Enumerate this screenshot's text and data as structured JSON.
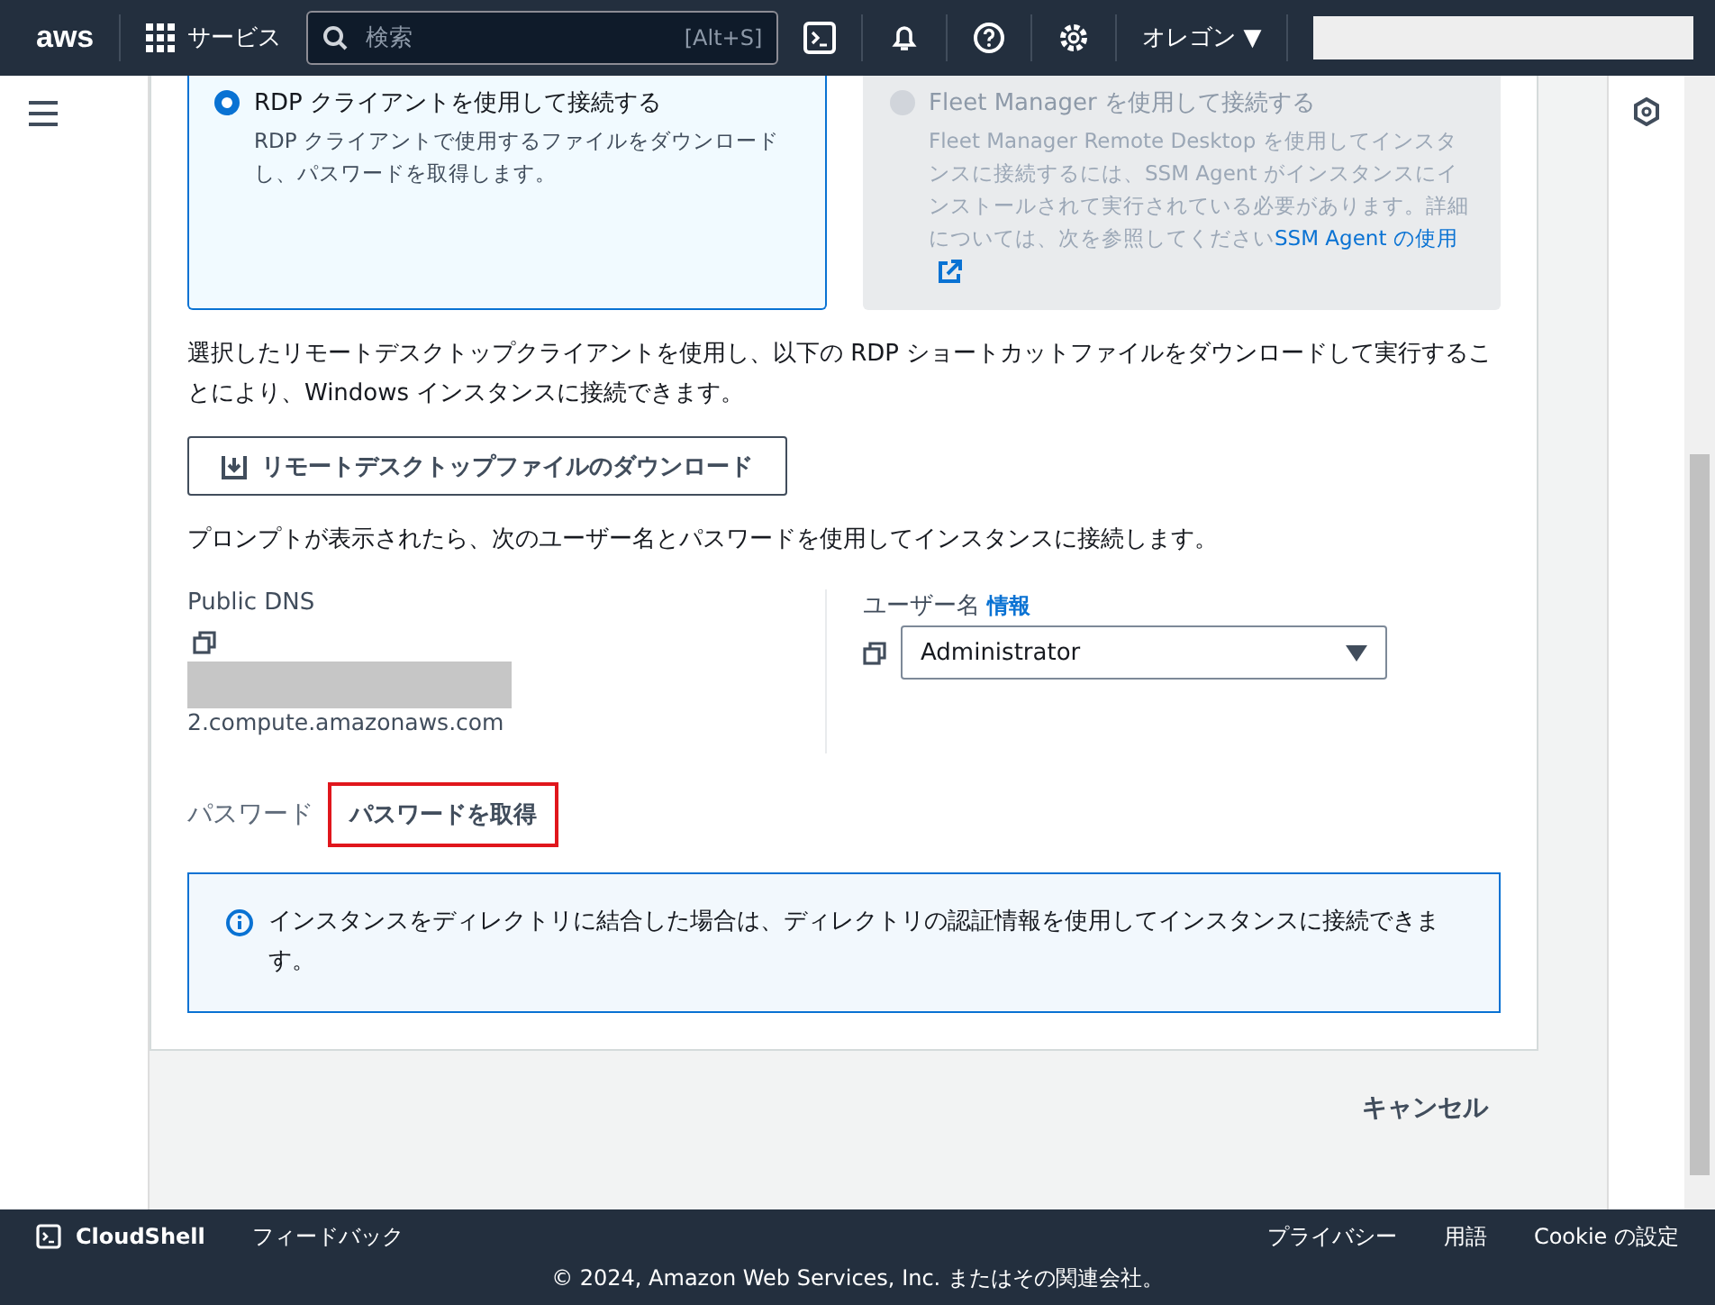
{
  "header": {
    "logo": "aws",
    "services": "サービス",
    "search": {
      "placeholder": "検索",
      "shortcut": "[Alt+S]"
    },
    "region": "オレゴン ▼"
  },
  "options": [
    {
      "title": "RDP クライアントを使用して接続する",
      "description": "RDP クライアントで使用するファイルをダウンロードし、パスワードを取得します。",
      "selected": true,
      "disabled": false
    },
    {
      "title": "Fleet Manager を使用して接続する",
      "description": "Fleet Manager Remote Desktop を使用してインスタンスに接続するには、SSM Agent がインスタンスにインストールされて実行されている必要があります。詳細については、次を参照してください",
      "link": "SSM Agent の使用",
      "selected": false,
      "disabled": true
    }
  ],
  "intro": "選択したリモートデスクトップクライアントを使用し、以下の RDP ショートカットファイルをダウンロードして実行することにより、Windows インスタンスに接続できます。",
  "download_button": "リモートデスクトップファイルのダウンロード",
  "prompt": "プロンプトが表示されたら、次のユーザー名とパスワードを使用してインスタンスに接続します。",
  "public_dns": {
    "label": "Public DNS",
    "value_tail": "2.compute.amazonaws.com"
  },
  "username": {
    "label": "ユーザー名",
    "info": "情報",
    "value": "Administrator"
  },
  "password": {
    "label": "パスワード",
    "button": "パスワードを取得"
  },
  "info_alert": "インスタンスをディレクトリに結合した場合は、ディレクトリの認証情報を使用してインスタンスに接続できます。",
  "cancel": "キャンセル",
  "footer": {
    "left": [
      "CloudShell",
      "フィードバック"
    ],
    "right": [
      "プライバシー",
      "用語",
      "Cookie の設定"
    ],
    "copyright": "© 2024, Amazon Web Services, Inc. またはその関連会社。"
  }
}
